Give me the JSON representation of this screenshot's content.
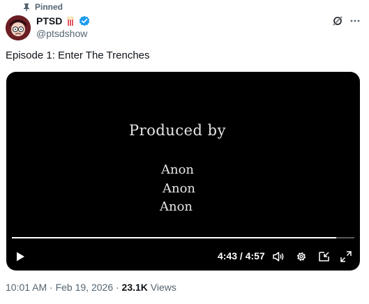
{
  "pinned": {
    "label": "Pinned",
    "icon": "pin-icon"
  },
  "author": {
    "name": "PTSD",
    "emoji": "popcorn-emoji",
    "verified_icon": "verified-badge-icon",
    "handle": "@ptsdshow",
    "avatar": "avatar"
  },
  "header_actions": {
    "grok_icon": "grok-icon",
    "more_icon": "more-icon"
  },
  "tweet": {
    "text": "Episode 1: Enter The Trenches"
  },
  "video": {
    "credits": {
      "title": "Produced by",
      "names": [
        "Anon",
        "Anon",
        "Anon"
      ]
    },
    "progress_fraction": 0.947,
    "time": "4:43 / 4:57",
    "controls": {
      "play": "play-icon",
      "volume": "volume-icon",
      "settings": "settings-gear-icon",
      "pip": "picture-in-picture-icon",
      "fullscreen": "fullscreen-icon"
    }
  },
  "meta": {
    "timestamp": "10:01 AM · Feb 19, 2026 · ",
    "views_count": "23.1K",
    "views_label": " Views"
  },
  "colors": {
    "text_primary": "#0f1419",
    "text_secondary": "#536471",
    "verified_blue": "#1d9bf0",
    "video_bg": "#000000"
  }
}
